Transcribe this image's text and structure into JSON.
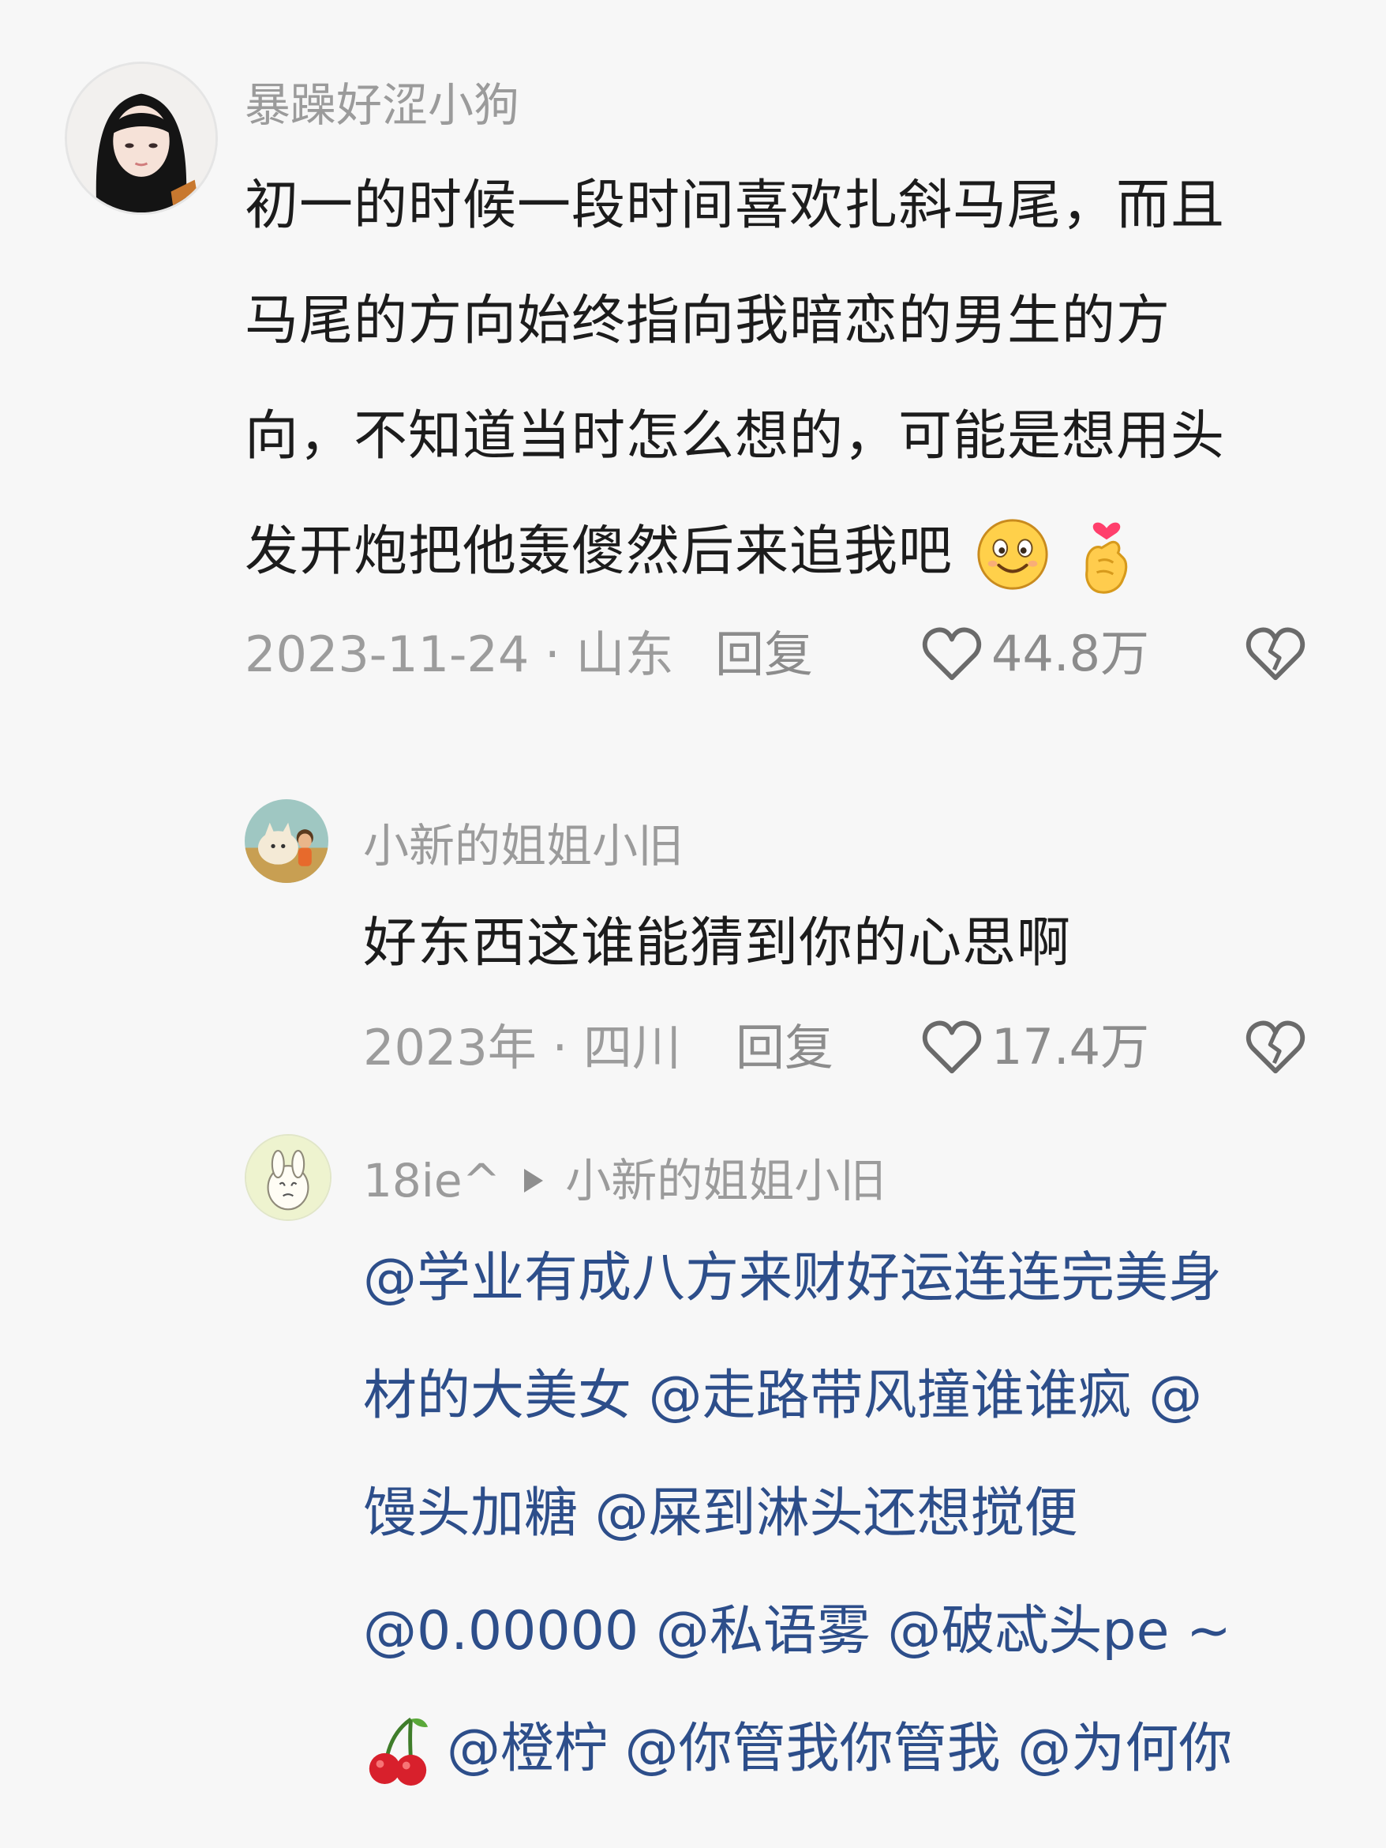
{
  "comments": [
    {
      "username": "暴躁好涩小狗",
      "text": "初一的时候一段时间喜欢扎斜马尾，而且马尾的方向始终指向我暗恋的男生的方向，不知道当时怎么想的，可能是想用头发开炮把他轰傻然后来追我吧",
      "lines": [
        "初一的时候一段时间喜欢扎斜马尾，而且",
        "马尾的方向始终指向我暗恋的男生的方",
        "向，不知道当时怎么想的，可能是想用头",
        "发开炮把他轰傻然后来追我吧"
      ],
      "date": "2023-11-24",
      "location": "山东",
      "meta": "2023-11-24 · 山东",
      "reply_label": "回复",
      "likes": "44.8万"
    },
    {
      "username": "小新的姐姐小旧",
      "text": "好东西这谁能猜到你的心思啊",
      "meta": "2023年 · 四川",
      "reply_label": "回复",
      "likes": "17.4万"
    },
    {
      "username": "18ie^",
      "reply_to": "小新的姐姐小旧",
      "lines": [
        "@学业有成八方来财好运连连完美身",
        "材的大美女 @走路带风撞谁谁疯 @",
        "馒头加糖 @屎到淋头还想搅便",
        "@0.00000 @私语雾 @破忒头pe ~",
        "@橙柠 @你管我你管我 @为何你"
      ]
    }
  ],
  "icons": {
    "like": "heart-outline-icon",
    "dislike": "broken-heart-icon",
    "reply_arrow": "triangle-right-icon",
    "emoji_smile": "smiling-face-icon",
    "emoji_finger_heart": "finger-heart-icon",
    "emoji_cherry": "cherries-icon"
  },
  "colors": {
    "background": "#f7f7f7",
    "text": "#1c1c1c",
    "muted": "#9c9c9c",
    "mention": "#2d4e8a"
  }
}
